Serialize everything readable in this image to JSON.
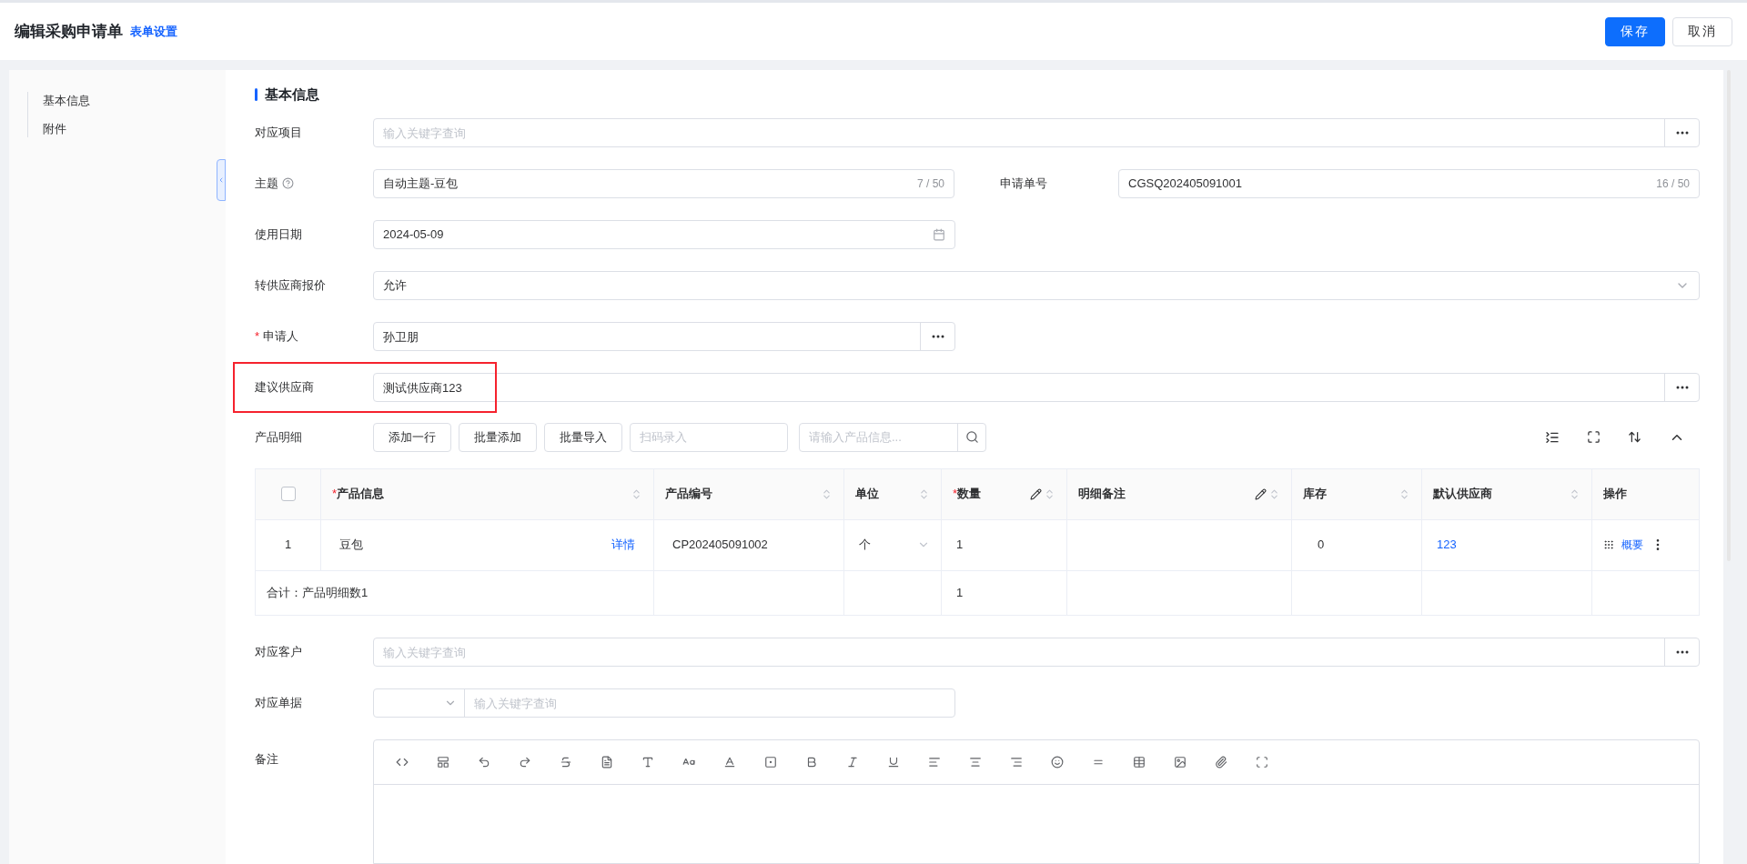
{
  "header": {
    "title": "编辑采购申请单",
    "settings_link": "表单设置",
    "buttons": [
      {
        "label": "保存",
        "kind": "primary"
      },
      {
        "label": "取消",
        "kind": "default"
      }
    ]
  },
  "sidebar": {
    "items": [
      "基本信息",
      "附件"
    ]
  },
  "section_title": "基本信息",
  "rows": [
    {
      "fields": [
        {
          "label": "对应项目",
          "kind": "search",
          "placeholder": "输入关键字查询",
          "help": false,
          "highlighted": false
        }
      ]
    },
    {
      "fields": [
        {
          "label": "主题",
          "kind": "text",
          "value": "自动主题-豆包",
          "counter": "7 / 50",
          "help": true,
          "highlighted": false
        },
        {
          "label": "申请单号",
          "kind": "text",
          "value": "CGSQ202405091001",
          "counter": "16 / 50",
          "help": false,
          "highlighted": false
        }
      ]
    },
    {
      "fields": [
        {
          "label": "使用日期",
          "kind": "date",
          "value": "2024-05-09",
          "help": false,
          "highlighted": false
        }
      ]
    },
    {
      "fields": [
        {
          "label": "转供应商报价",
          "kind": "select",
          "value": "允许",
          "help": false,
          "highlighted": false
        }
      ]
    },
    {
      "fields": [
        {
          "label": "申请人",
          "kind": "person",
          "value": "孙卫朋",
          "required_mark": "*",
          "help": false,
          "highlighted": false
        }
      ]
    },
    {
      "fields": [
        {
          "label": "建议供应商",
          "kind": "search",
          "value": "测试供应商123",
          "help": false,
          "highlighted": true
        }
      ]
    }
  ],
  "products": {
    "label": "产品明细",
    "buttons": [
      "添加一行",
      "批量添加",
      "批量导入"
    ],
    "scan_placeholder": "扫码录入",
    "search_placeholder": "请输入产品信息...",
    "select_all": {
      "checked": false
    },
    "columns": [
      {
        "label": "产品信息",
        "required_mark": "*",
        "editable": false,
        "sortable": true
      },
      {
        "label": "产品编号",
        "editable": false,
        "sortable": true
      },
      {
        "label": "单位",
        "editable": false,
        "sortable": true
      },
      {
        "label": "数量",
        "required_mark": "*",
        "editable": true,
        "sortable": true
      },
      {
        "label": "明细备注",
        "editable": true,
        "sortable": true
      },
      {
        "label": "库存",
        "editable": false,
        "sortable": true
      },
      {
        "label": "默认供应商",
        "editable": false,
        "sortable": true
      },
      {
        "label": "操作",
        "editable": false,
        "sortable": false
      }
    ],
    "rows": [
      {
        "index": "1",
        "product": "豆包",
        "detail_link": "详情",
        "code": "CP202405091002",
        "unit": "个",
        "quantity": "1",
        "stock": "0",
        "supplier": "123",
        "action": "概要"
      }
    ],
    "total": {
      "label": "合计：产品明细数1",
      "quantity": "1"
    }
  },
  "lower_fields": [
    {
      "label": "对应客户",
      "kind": "search",
      "placeholder": "输入关键字查询"
    },
    {
      "label": "对应单据",
      "kind": "doc",
      "placeholder": "输入关键字查询"
    }
  ],
  "remarks": {
    "label": "备注"
  }
}
